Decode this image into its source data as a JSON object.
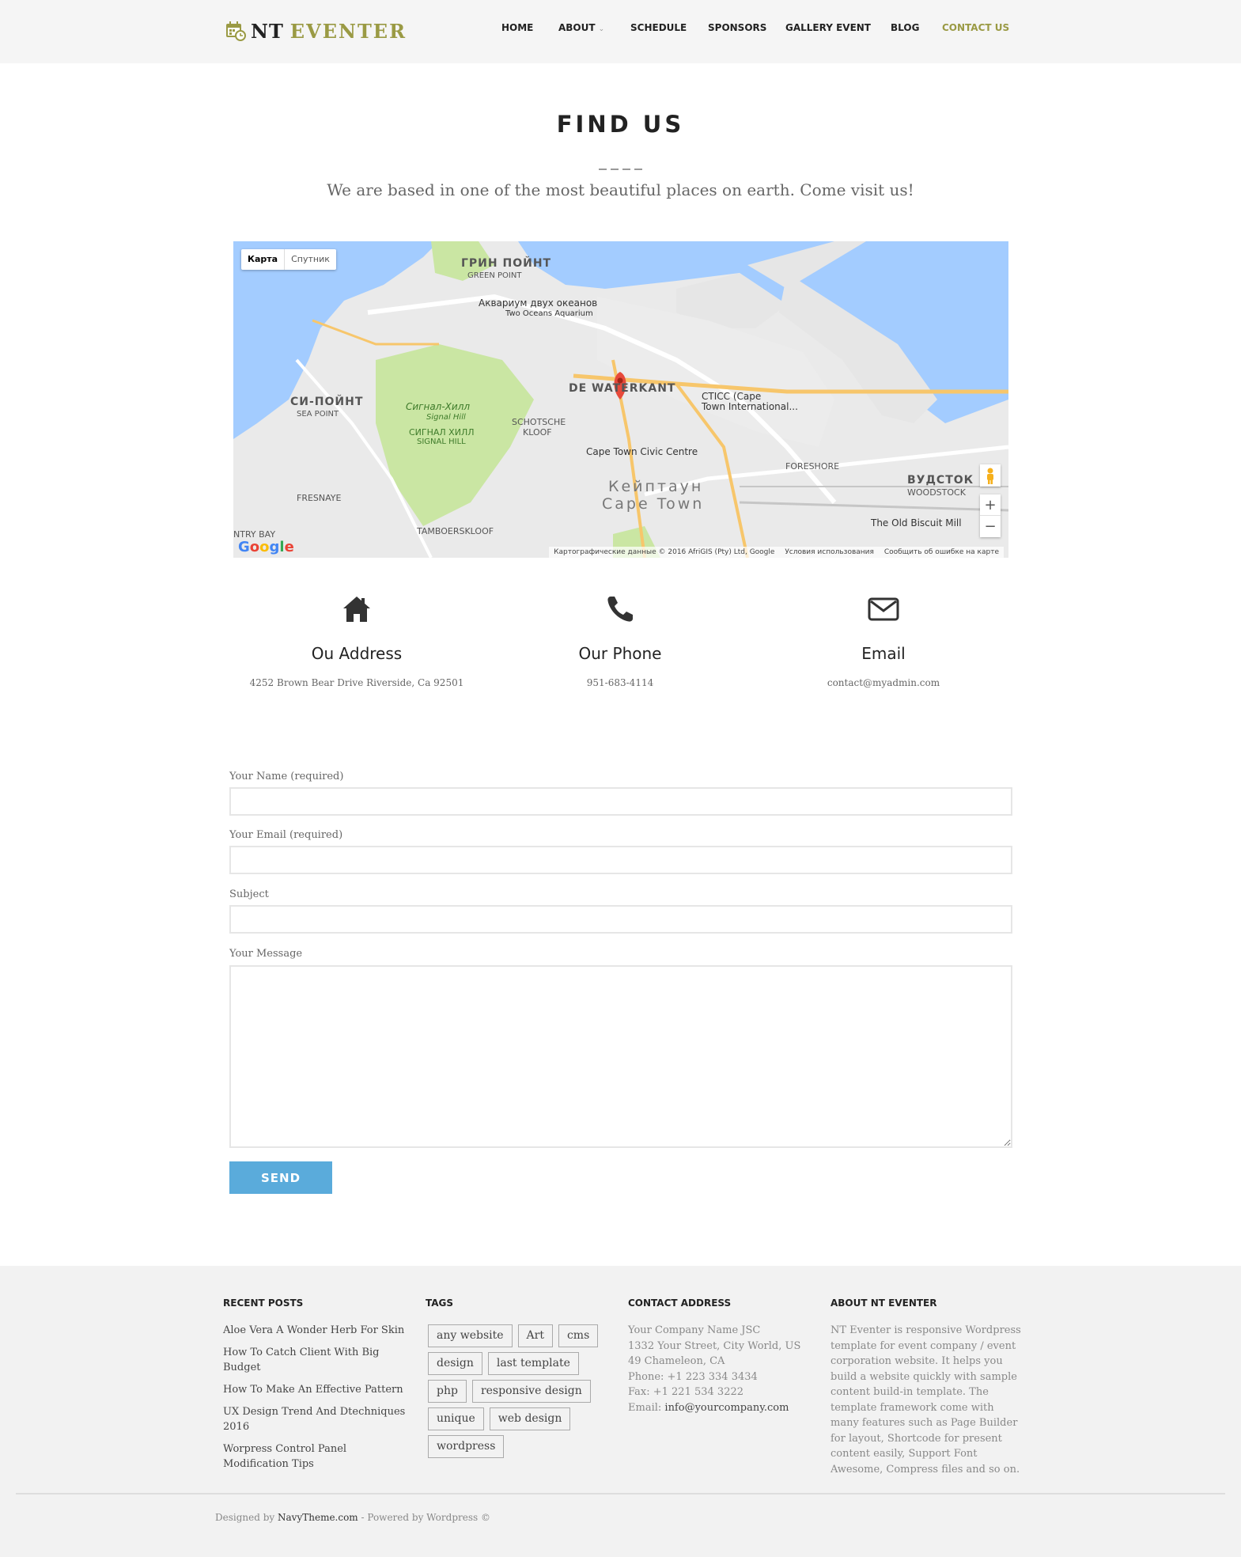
{
  "header": {
    "logo_nt": "NT",
    "logo_eventer": "EVENTER",
    "nav": [
      {
        "label": "HOME"
      },
      {
        "label": "ABOUT"
      },
      {
        "label": "SCHEDULE"
      },
      {
        "label": "SPONSORS"
      },
      {
        "label": "GALLERY EVENT"
      },
      {
        "label": "BLOG"
      },
      {
        "label": "CONTACT US"
      }
    ],
    "active_color": "#9a9a44"
  },
  "find_us": {
    "title": "FIND US",
    "subtitle": "We are based in one of the most beautiful places on earth. Come visit us!"
  },
  "map": {
    "type_map": "Карта",
    "type_satellite": "Спутник",
    "google": "Google",
    "footer_data": "Картографические данные © 2016 AfriGIS (Pty) Ltd, Google",
    "footer_terms": "Условия использования",
    "footer_report": "Сообщить об ошибке на карте",
    "zoom_in": "+",
    "zoom_out": "−",
    "labels": {
      "green_point_ru": "ГРИН ПОЙНТ",
      "green_point": "GREEN POINT",
      "aquarium_ru": "Аквариум двух океанов",
      "aquarium": "Two Oceans Aquarium",
      "sea_point_ru": "СИ-ПОЙНТ",
      "sea_point": "SEA POINT",
      "signal_hill_ru": "Сигнал-Хилл",
      "signal_hill": "Signal Hill",
      "signal_hill_ru2": "СИГНАЛ ХИЛЛ",
      "signal_hill2": "SIGNAL HILL",
      "schotsche": "SCHOTSCHE",
      "kloof": "KLOOF",
      "de_waterkant": "DE WATERKANT",
      "cticc": "CTICC (Cape",
      "cticc2": "Town International...",
      "civic": "Cape Town Civic Centre",
      "capetown_ru": "Кейптаун",
      "capetown": "Cape Town",
      "fresnaye": "FRESNAYE",
      "tamboerskloof": "TAMBOERSKLOOF",
      "foreshore": "FORESHORE",
      "woodstock_ru": "ВУДСТОК",
      "woodstock": "WOODSTOCK",
      "biscuit_mill": "The Old Biscuit Mill",
      "ntry_bay": "NTRY BAY"
    }
  },
  "info": [
    {
      "title": "Ou Address",
      "text": "4252 Brown Bear Drive Riverside, Ca 92501",
      "icon": "home-icon"
    },
    {
      "title": "Our Phone",
      "text": "951-683-4114",
      "icon": "phone-icon"
    },
    {
      "title": "Email",
      "text": "contact@myadmin.com",
      "icon": "envelope-icon"
    }
  ],
  "form": {
    "name_label": "Your Name (required)",
    "email_label": "Your Email (required)",
    "subject_label": "Subject",
    "message_label": "Your Message",
    "send": "SEND",
    "button_color": "#5aabdb"
  },
  "footer": {
    "recent_title": "RECENT POSTS",
    "posts": [
      "Aloe Vera A Wonder Herb For Skin",
      "How To Catch Client With Big Budget",
      "How To Make An Effective Pattern",
      "UX Design Trend And Dtechniques 2016",
      "Worpress Control Panel Modification Tips"
    ],
    "tags_title": "TAGS",
    "tags": [
      "any website",
      "Art",
      "cms",
      "design",
      "last template",
      "php",
      "responsive design",
      "unique",
      "web design",
      "wordpress"
    ],
    "contact_title": "CONTACT ADDRESS",
    "contact": {
      "company": "Your Company Name JSC",
      "street": "1332 Your Street, City World, US",
      "city": "49 Chameleon, CA",
      "phone": "Phone: +1 223 334 3434",
      "fax": "Fax: +1 221 534 3222",
      "email_prefix": "Email: ",
      "email": "info@yourcompany.com"
    },
    "about_title": "ABOUT NT EVENTER",
    "about_text": "NT Eventer is responsive Wordpress template for event company / event corporation website. It helps you build a website quickly with sample content build-in template. The template framework come with many features such as Page Builder for layout, Shortcode for present content easily, Support Font Awesome, Compress files and so on.",
    "copyright_prefix": "Designed by ",
    "copyright_brand": "NavyTheme.com",
    "copyright_suffix": " - Powered by Wordpress ©"
  }
}
